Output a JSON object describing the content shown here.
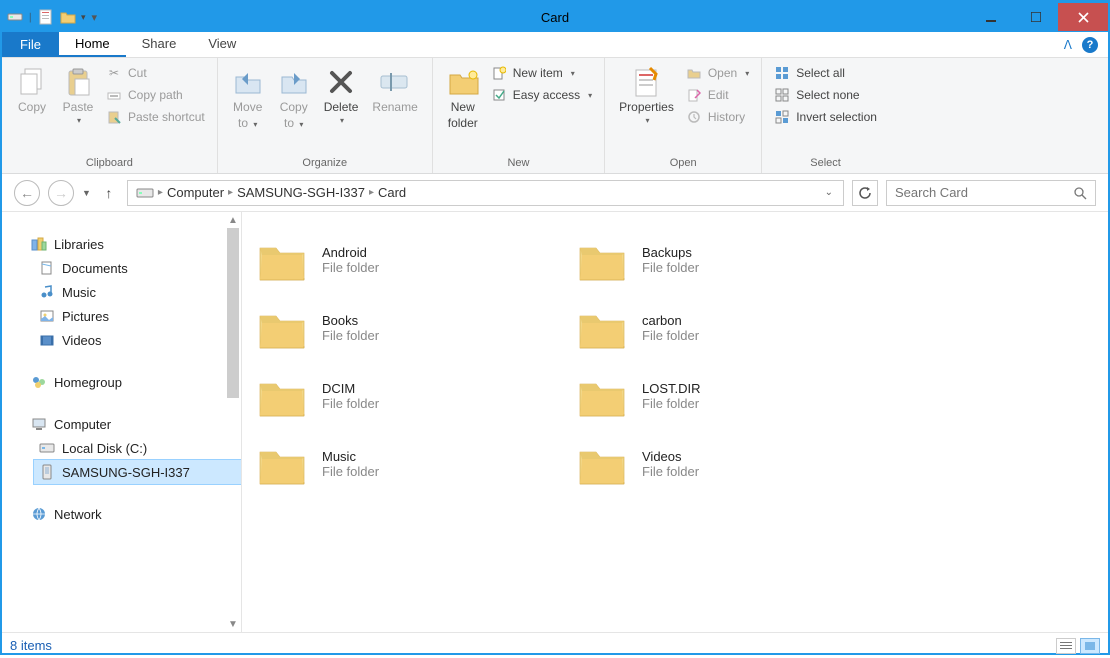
{
  "window": {
    "title": "Card"
  },
  "tabs": {
    "file": "File",
    "home": "Home",
    "share": "Share",
    "view": "View"
  },
  "ribbon": {
    "clipboard": {
      "label": "Clipboard",
      "copy": "Copy",
      "paste": "Paste",
      "cut": "Cut",
      "copy_path": "Copy path",
      "paste_shortcut": "Paste shortcut"
    },
    "organize": {
      "label": "Organize",
      "move_to": "Move",
      "move_to2": "to",
      "copy_to": "Copy",
      "copy_to2": "to",
      "delete": "Delete",
      "rename": "Rename"
    },
    "new": {
      "label": "New",
      "new_folder": "New",
      "new_folder2": "folder",
      "new_item": "New item",
      "easy_access": "Easy access"
    },
    "open": {
      "label": "Open",
      "properties": "Properties",
      "open": "Open",
      "edit": "Edit",
      "history": "History"
    },
    "select": {
      "label": "Select",
      "select_all": "Select all",
      "select_none": "Select none",
      "invert": "Invert selection"
    }
  },
  "breadcrumb": {
    "segments": [
      "Computer",
      "SAMSUNG-SGH-I337",
      "Card"
    ]
  },
  "search": {
    "placeholder": "Search Card"
  },
  "sidebar": {
    "libraries": "Libraries",
    "lib_items": [
      "Documents",
      "Music",
      "Pictures",
      "Videos"
    ],
    "homegroup": "Homegroup",
    "computer": "Computer",
    "comp_items": [
      "Local Disk (C:)",
      "SAMSUNG-SGH-I337"
    ],
    "network": "Network"
  },
  "items": [
    {
      "name": "Android",
      "type": "File folder"
    },
    {
      "name": "Backups",
      "type": "File folder"
    },
    {
      "name": "Books",
      "type": "File folder"
    },
    {
      "name": "carbon",
      "type": "File folder"
    },
    {
      "name": "DCIM",
      "type": "File folder"
    },
    {
      "name": "LOST.DIR",
      "type": "File folder"
    },
    {
      "name": "Music",
      "type": "File folder"
    },
    {
      "name": "Videos",
      "type": "File folder"
    }
  ],
  "status": {
    "count": "8 items"
  }
}
